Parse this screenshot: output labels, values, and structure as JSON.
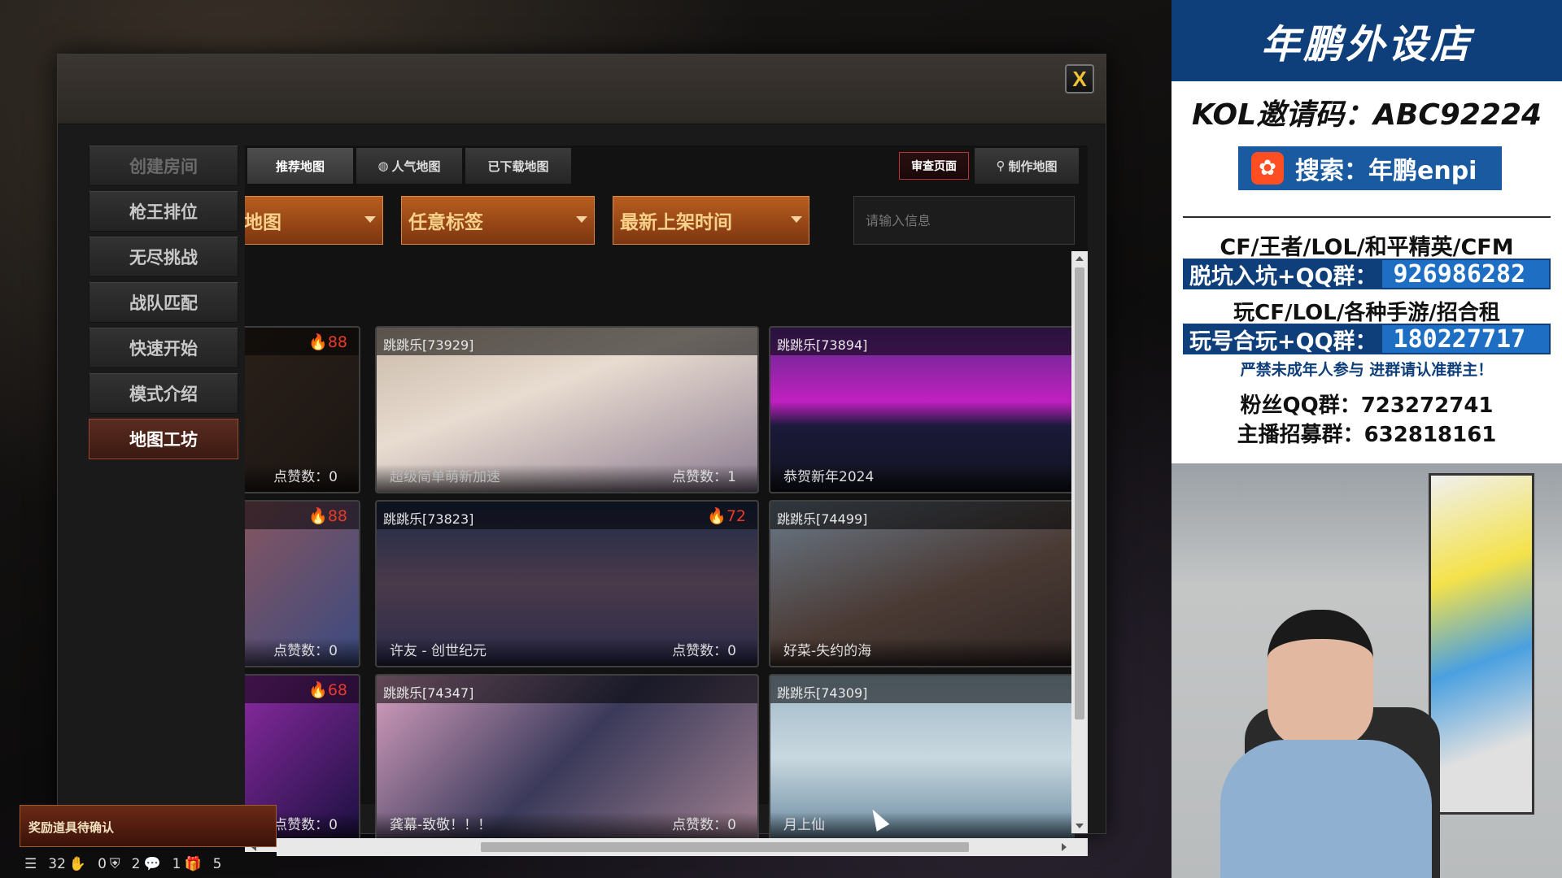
{
  "dialog": {
    "close_label": "X"
  },
  "sidebar": {
    "items": [
      {
        "label": "创建房间"
      },
      {
        "label": "枪王排位"
      },
      {
        "label": "无尽挑战"
      },
      {
        "label": "战队匹配"
      },
      {
        "label": "快速开始"
      },
      {
        "label": "模式介绍"
      },
      {
        "label": "地图工坊"
      }
    ],
    "active_index": 6
  },
  "tabs": {
    "recommended": "推荐地图",
    "popular": "人气地图",
    "downloaded": "已下载地图",
    "review": "审查页面",
    "create": "制作地图"
  },
  "filters": {
    "map_type": "地图",
    "tag": "任意标签",
    "sort": "最新上架时间",
    "search_placeholder": "请输入信息"
  },
  "cards": [
    {
      "id": "",
      "hot": "88",
      "name": "",
      "likes": "点赞数：0"
    },
    {
      "id": "跳跳乐[73929]",
      "hot": "",
      "name": "超级简单萌新加速",
      "likes": "点赞数：1"
    },
    {
      "id": "跳跳乐[73894]",
      "hot": "",
      "name": "恭贺新年2024",
      "likes": ""
    },
    {
      "id": "",
      "hot": "88",
      "name": "",
      "likes": "点赞数：0"
    },
    {
      "id": "跳跳乐[73823]",
      "hot": "72",
      "name": "许友 - 创世纪元",
      "likes": "点赞数：0"
    },
    {
      "id": "跳跳乐[74499]",
      "hot": "",
      "name": "好菜-失约的海",
      "likes": ""
    },
    {
      "id": "",
      "hot": "68",
      "name": "",
      "likes": "点赞数：0"
    },
    {
      "id": "跳跳乐[74347]",
      "hot": "",
      "name": "龚幕-致敬！！！",
      "likes": "点赞数：0"
    },
    {
      "id": "跳跳乐[74309]",
      "hot": "",
      "name": "月上仙",
      "likes": ""
    }
  ],
  "hud": {
    "reward_text": "奖励道具待确认",
    "stat1": "32",
    "stat2": "0",
    "stat3": "2",
    "stat4": "1",
    "stat5": "5"
  },
  "overlay": {
    "title": "年鹏外设店",
    "kol": "KOL邀请码：ABC92224",
    "search": "搜索：年鹏enpi",
    "line1": "CF/王者/LOL/和平精英/CFM",
    "group1_label": "脱坑入坑+QQ群：",
    "group1_num": "926986282",
    "line2": "玩CF/LOL/各种手游/招合租",
    "group2_label": "玩号合玩+QQ群：",
    "group2_num": "180227717",
    "warning": "严禁未成年人参与  进群请认准群主！",
    "fans": "粉丝QQ群：723272741",
    "recruit": "主播招募群：632818161"
  },
  "colors": {
    "accent_orange": "#b85e1e",
    "overlay_blue": "#0f3f7a",
    "hot_red": "#e83a2a"
  }
}
